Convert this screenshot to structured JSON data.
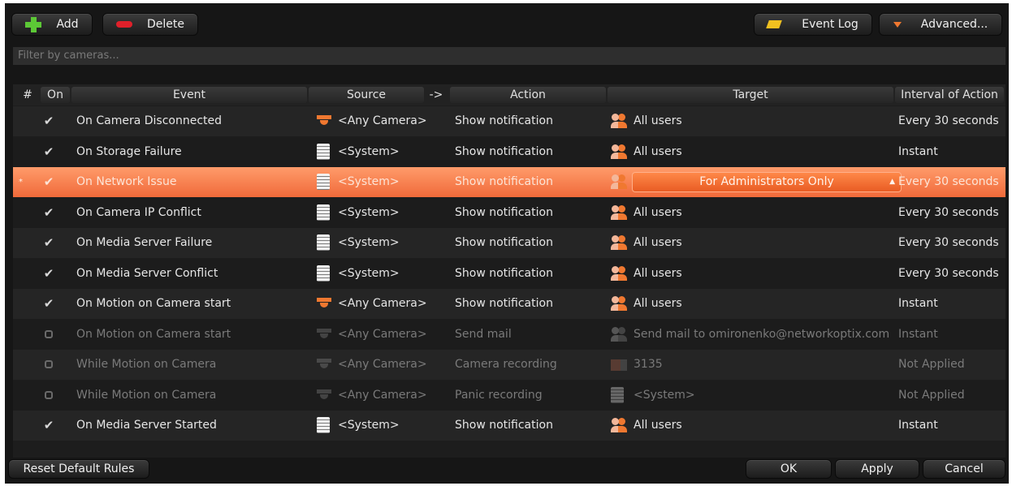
{
  "toolbar": {
    "add_label": "Add",
    "delete_label": "Delete",
    "event_log_label": "Event Log",
    "advanced_label": "Advanced..."
  },
  "filter": {
    "placeholder": "Filter by cameras..."
  },
  "columns": {
    "num": "#",
    "on": "On",
    "event": "Event",
    "source": "Source",
    "arrow": "->",
    "action": "Action",
    "target": "Target",
    "interval": "Interval of Action"
  },
  "rules": [
    {
      "on": true,
      "event": "On Camera Disconnected",
      "source": "<Any Camera>",
      "source_icon": "camera-icon",
      "action": "Show notification",
      "target": "All users",
      "target_icon": "users-icon",
      "interval": "Every 30 seconds",
      "enabled": true
    },
    {
      "on": true,
      "event": "On Storage Failure",
      "source": "<System>",
      "source_icon": "server-icon",
      "action": "Show notification",
      "target": "All users",
      "target_icon": "users-icon",
      "interval": "Instant",
      "enabled": true
    },
    {
      "on": true,
      "event": "On Network Issue",
      "source": "<System>",
      "source_icon": "server-icon",
      "action": "Show notification",
      "target": "For Administrators Only",
      "target_icon": "user-icon",
      "interval": "Every 30 seconds",
      "enabled": true,
      "selected": true,
      "modified_marker": "*"
    },
    {
      "on": true,
      "event": "On Camera IP Conflict",
      "source": "<System>",
      "source_icon": "server-icon",
      "action": "Show notification",
      "target": "All users",
      "target_icon": "users-icon",
      "interval": "Every 30 seconds",
      "enabled": true
    },
    {
      "on": true,
      "event": "On Media Server Failure",
      "source": "<System>",
      "source_icon": "server-icon",
      "action": "Show notification",
      "target": "All users",
      "target_icon": "users-icon",
      "interval": "Every 30 seconds",
      "enabled": true
    },
    {
      "on": true,
      "event": "On Media Server Conflict",
      "source": "<System>",
      "source_icon": "server-icon",
      "action": "Show notification",
      "target": "All users",
      "target_icon": "users-icon",
      "interval": "Every 30 seconds",
      "enabled": true
    },
    {
      "on": true,
      "event": "On Motion on Camera start",
      "source": "<Any Camera>",
      "source_icon": "camera-icon",
      "action": "Show notification",
      "target": "All users",
      "target_icon": "users-icon",
      "interval": "Instant",
      "enabled": true
    },
    {
      "on": false,
      "event": "On Motion on Camera start",
      "source": "<Any Camera>",
      "source_icon": "camera-icon",
      "action": "Send mail",
      "target": "Send mail to omironenko@networkoptix.com",
      "target_icon": "users-icon",
      "interval": "Instant",
      "enabled": false
    },
    {
      "on": false,
      "event": "While Motion on Camera",
      "source": "<Any Camera>",
      "source_icon": "camera-icon",
      "action": "Camera recording",
      "target": "3135",
      "target_icon": "recording-camera-icon",
      "interval": "Not Applied",
      "enabled": false
    },
    {
      "on": false,
      "event": "While Motion on Camera",
      "source": "<Any Camera>",
      "source_icon": "camera-icon",
      "action": "Panic recording",
      "target": "<System>",
      "target_icon": "server-icon",
      "interval": "Not Applied",
      "enabled": false
    },
    {
      "on": true,
      "event": "On Media Server Started",
      "source": "<System>",
      "source_icon": "server-icon",
      "action": "Show notification",
      "target": "All users",
      "target_icon": "users-icon",
      "interval": "Instant",
      "enabled": true
    }
  ],
  "footer": {
    "reset_label": "Reset Default Rules",
    "ok_label": "OK",
    "apply_label": "Apply",
    "cancel_label": "Cancel"
  },
  "colors": {
    "accent": "#f07830",
    "selected_row": "#f47a45",
    "add_green": "#5cc836",
    "delete_red": "#e0202a"
  }
}
